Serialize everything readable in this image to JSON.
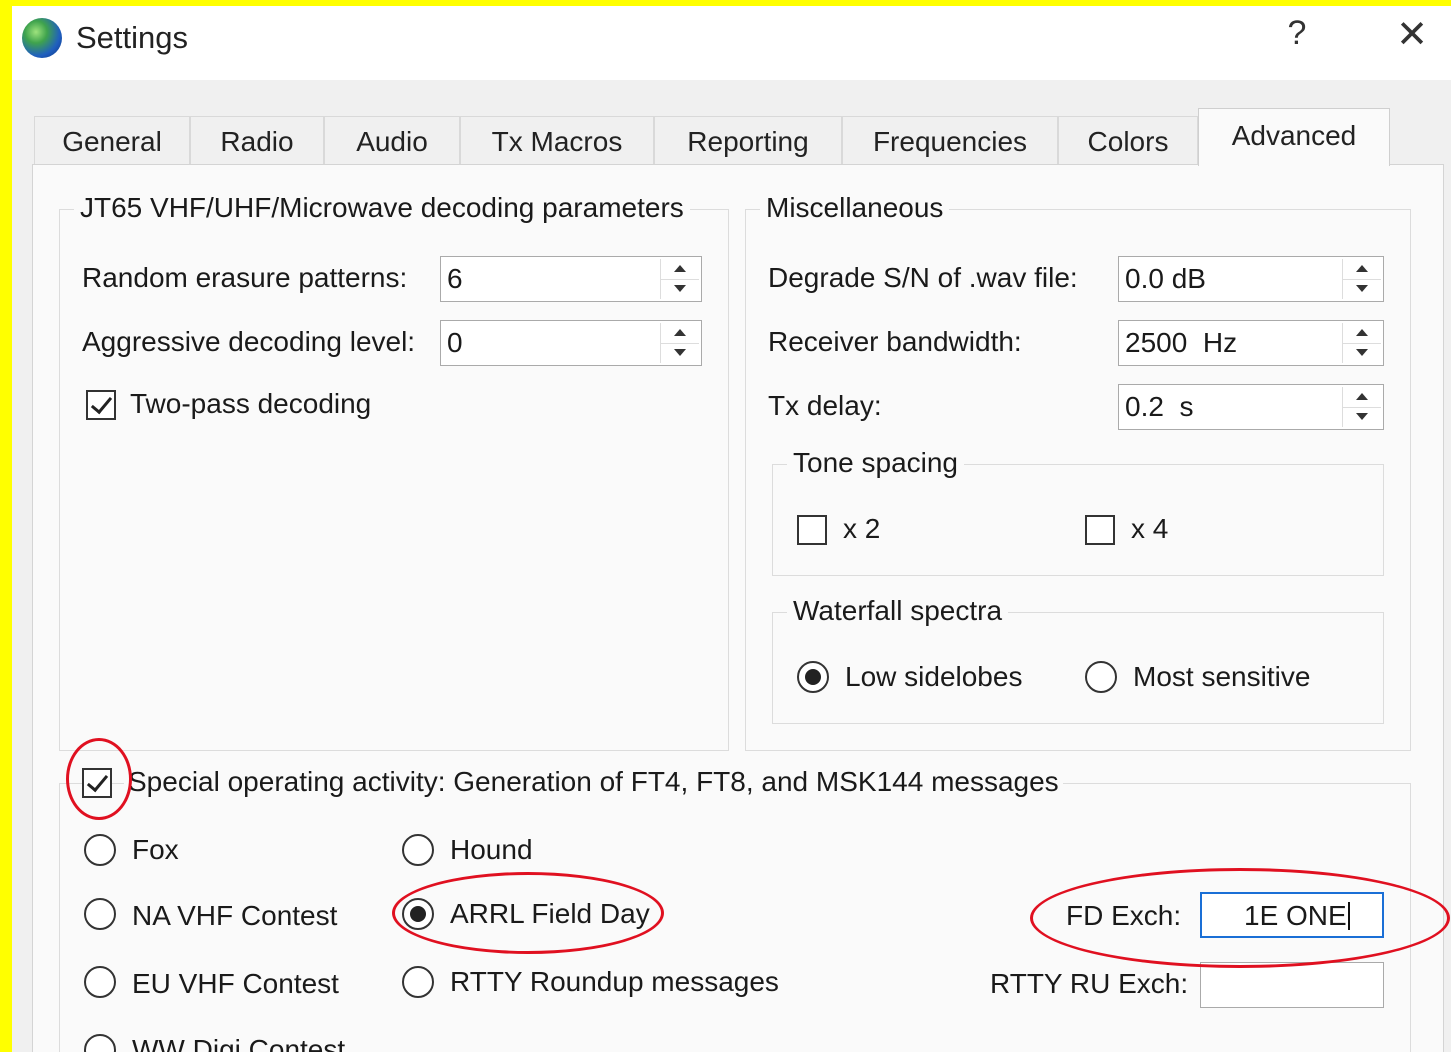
{
  "window": {
    "title": "Settings",
    "help_glyph": "?",
    "close_glyph": "✕"
  },
  "tabs": [
    {
      "label": "General"
    },
    {
      "label": "Radio"
    },
    {
      "label": "Audio"
    },
    {
      "label": "Tx Macros"
    },
    {
      "label": "Reporting"
    },
    {
      "label": "Frequencies"
    },
    {
      "label": "Colors"
    },
    {
      "label": "Advanced"
    }
  ],
  "active_tab": "Advanced",
  "jt65": {
    "title": "JT65 VHF/UHF/Microwave decoding parameters",
    "random_erasure_label": "Random erasure patterns:",
    "random_erasure_value": "6",
    "aggressive_label": "Aggressive decoding level:",
    "aggressive_value": "0",
    "two_pass_label": "Two-pass decoding",
    "two_pass_checked": true
  },
  "misc": {
    "title": "Miscellaneous",
    "degrade_label": "Degrade S/N of .wav file:",
    "degrade_value": "0.0 dB",
    "bandwidth_label": "Receiver bandwidth:",
    "bandwidth_value": "2500  Hz",
    "txdelay_label": "Tx delay:",
    "txdelay_value": "0.2  s",
    "tone_spacing": {
      "title": "Tone spacing",
      "x2_label": "x 2",
      "x4_label": "x 4",
      "x2_checked": false,
      "x4_checked": false
    },
    "waterfall": {
      "title": "Waterfall spectra",
      "low_label": "Low sidelobes",
      "sensitive_label": "Most sensitive",
      "selected": "Low sidelobes"
    }
  },
  "special": {
    "title": "Special operating activity:  Generation of FT4, FT8, and MSK144 messages",
    "checked": true,
    "options": {
      "fox": "Fox",
      "hound": "Hound",
      "na_vhf": "NA VHF Contest",
      "arrl_fd": "ARRL Field Day",
      "eu_vhf": "EU VHF Contest",
      "rtty_roundup": "RTTY Roundup messages",
      "ww_digi": "WW Digi Contest"
    },
    "selected": "ARRL Field Day",
    "fd_exch_label": "FD Exch:",
    "fd_exch_value": "1E ONE",
    "rtty_exch_label": "RTTY RU Exch:",
    "rtty_exch_value": ""
  },
  "colors": {
    "annotation": "#e01020",
    "background_frame": "#ffff00",
    "focus": "#1a6fd6"
  }
}
